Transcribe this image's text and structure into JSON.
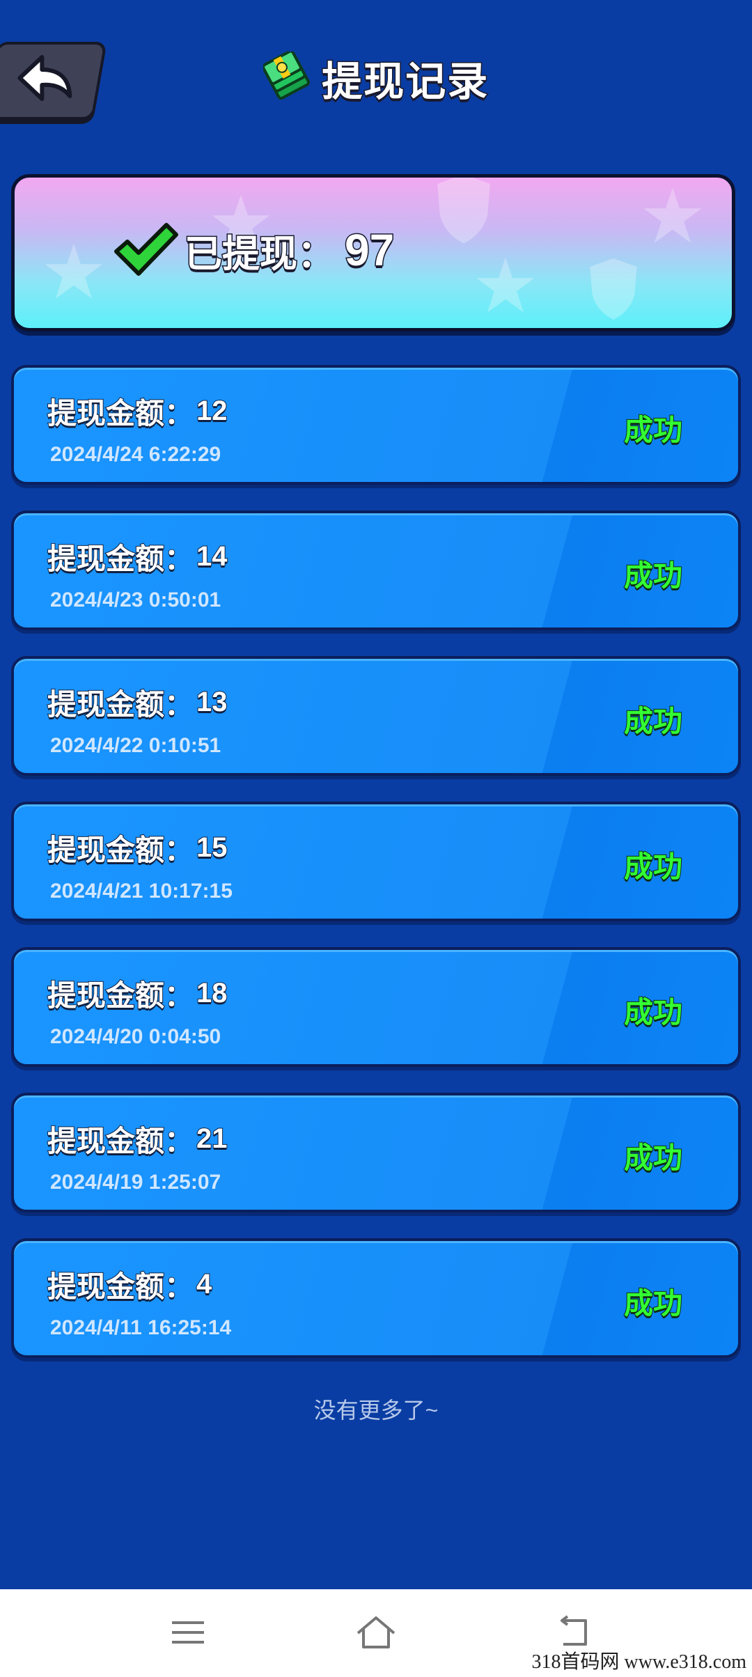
{
  "header": {
    "title": "提现记录",
    "back_icon": "back-arrow-icon",
    "title_icon": "money-stack-icon"
  },
  "summary": {
    "label": "已提现：",
    "value": "97",
    "icon": "green-checkmark-icon"
  },
  "records": [
    {
      "label": "提现金额：",
      "amount": "12",
      "time": "2024/4/24 6:22:29",
      "status": "成功"
    },
    {
      "label": "提现金额：",
      "amount": "14",
      "time": "2024/4/23 0:50:01",
      "status": "成功"
    },
    {
      "label": "提现金额：",
      "amount": "13",
      "time": "2024/4/22 0:10:51",
      "status": "成功"
    },
    {
      "label": "提现金额：",
      "amount": "15",
      "time": "2024/4/21 10:17:15",
      "status": "成功"
    },
    {
      "label": "提现金额：",
      "amount": "18",
      "time": "2024/4/20 0:04:50",
      "status": "成功"
    },
    {
      "label": "提现金额：",
      "amount": "21",
      "time": "2024/4/19 1:25:07",
      "status": "成功"
    },
    {
      "label": "提现金额：",
      "amount": "4",
      "time": "2024/4/11 16:25:14",
      "status": "成功"
    }
  ],
  "footer_text": "没有更多了~",
  "nav": {
    "menu_icon": "menu-icon",
    "home_icon": "home-icon",
    "back_icon": "back-icon"
  },
  "watermark": "318首码网 www.e318.com",
  "colors": {
    "background": "#0a3da3",
    "card": "#1a95ff",
    "success": "#33ff33"
  }
}
